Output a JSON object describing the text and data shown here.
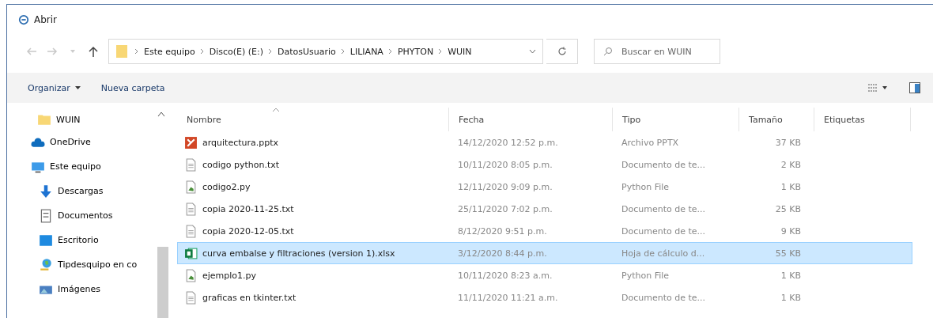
{
  "window": {
    "title": "Abrir"
  },
  "address": {
    "path": [
      "Este equipo",
      "Disco(E) (E:)",
      "DatosUsuario",
      "LILIANA",
      "PHYTON",
      "WUIN"
    ]
  },
  "search": {
    "placeholder": "Buscar en WUIN"
  },
  "toolbar": {
    "organize": "Organizar",
    "new_folder": "Nueva carpeta"
  },
  "sidebar": {
    "items": [
      {
        "label": "WUIN",
        "kind": "folder"
      },
      {
        "label": "OneDrive",
        "kind": "cloud"
      },
      {
        "label": "Este equipo",
        "kind": "pc"
      },
      {
        "label": "Descargas",
        "kind": "download"
      },
      {
        "label": "Documentos",
        "kind": "docs"
      },
      {
        "label": "Escritorio",
        "kind": "desktop"
      },
      {
        "label": "Tipdesquipo en co",
        "kind": "network"
      },
      {
        "label": "Imágenes",
        "kind": "pictures"
      }
    ]
  },
  "table": {
    "columns": [
      "Nombre",
      "Fecha",
      "Tipo",
      "Tamaño",
      "Etiquetas"
    ],
    "rows": [
      {
        "name": "arquitectura.pptx",
        "date": "14/12/2020 12:52 p.m.",
        "type": "Archivo PPTX",
        "size": "37 KB",
        "kind": "pptx",
        "selected": false
      },
      {
        "name": "codigo python.txt",
        "date": "10/11/2020 8:05 p.m.",
        "type": "Documento de te...",
        "size": "2 KB",
        "kind": "txt",
        "selected": false
      },
      {
        "name": "codigo2.py",
        "date": "12/11/2020 9:09 p.m.",
        "type": "Python File",
        "size": "1 KB",
        "kind": "py",
        "selected": false
      },
      {
        "name": "copia 2020-11-25.txt",
        "date": "25/11/2020 7:02 p.m.",
        "type": "Documento de te...",
        "size": "25 KB",
        "kind": "txt",
        "selected": false
      },
      {
        "name": "copia 2020-12-05.txt",
        "date": "8/12/2020 9:51 p.m.",
        "type": "Documento de te...",
        "size": "9 KB",
        "kind": "txt",
        "selected": false
      },
      {
        "name": "curva embalse y filtraciones (version 1).xlsx",
        "date": "3/12/2020 8:44 p.m.",
        "type": "Hoja de cálculo d...",
        "size": "55 KB",
        "kind": "xlsx",
        "selected": true
      },
      {
        "name": "ejemplo1.py",
        "date": "10/11/2020 8:23 a.m.",
        "type": "Python File",
        "size": "1 KB",
        "kind": "py",
        "selected": false
      },
      {
        "name": "graficas en tkinter.txt",
        "date": "11/11/2020 11:21 a.m.",
        "type": "Documento de te...",
        "size": "1 KB",
        "kind": "txt",
        "selected": false
      }
    ]
  }
}
